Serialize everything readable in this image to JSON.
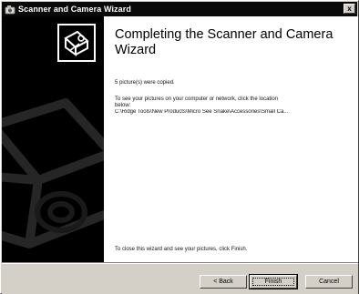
{
  "window": {
    "title": "Scanner and Camera Wizard",
    "close_label": "x"
  },
  "wizard": {
    "heading": "Completing the Scanner and Camera Wizard",
    "copied_text": "5 picture(s) were copied.",
    "view_text_line1": "To see your pictures on your computer or network, click the location",
    "view_text_line2": "below:",
    "location_link": "C:\\Ridge Tools\\New Products\\Micro See Snake\\Accessories\\Small Ca...",
    "close_text": "To close this wizard and see your pictures, click Finish."
  },
  "buttons": {
    "back": "< Back",
    "finish": "Finish",
    "cancel": "Cancel"
  },
  "colors": {
    "titlebar": "#0a0a0a",
    "panel": "#000000",
    "face": "#d4d0c8"
  },
  "icons": {
    "app": "scanner-camera-icon",
    "wizard": "camera-photo-icon"
  }
}
